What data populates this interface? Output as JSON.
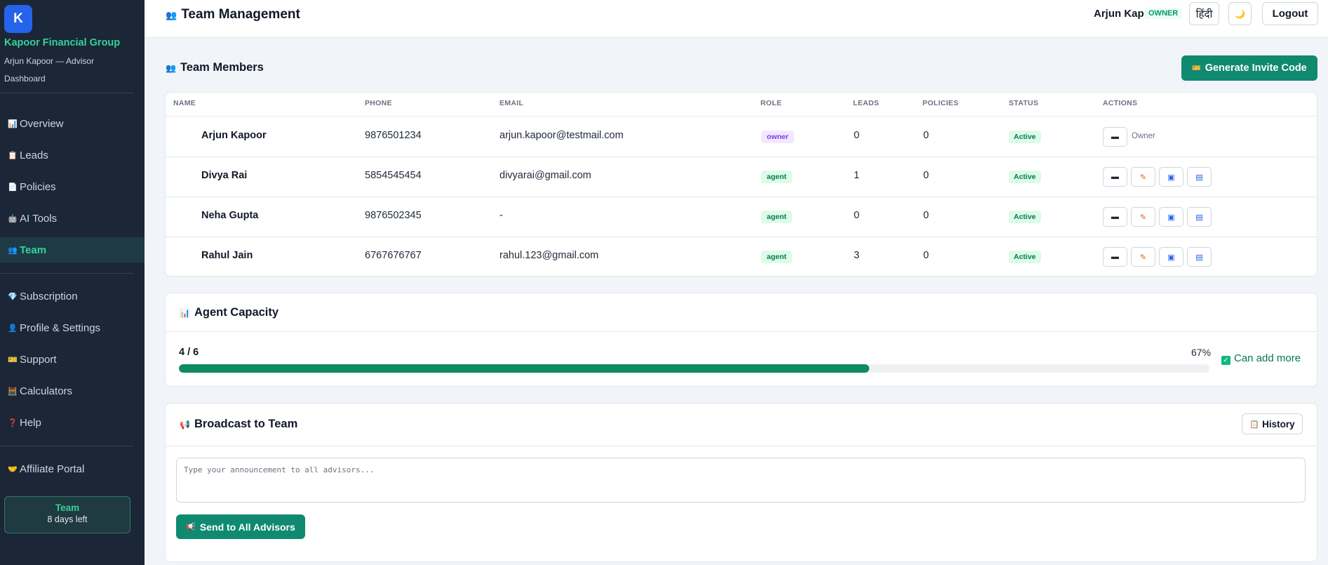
{
  "sidebar": {
    "logo_letter": "K",
    "org_name": "Kapoor Financial Group",
    "subtitle": "Arjun Kapoor — Advisor",
    "subtitle2": "Dashboard",
    "items": [
      {
        "icon": "📊",
        "label": "Overview"
      },
      {
        "icon": "📋",
        "label": "Leads"
      },
      {
        "icon": "📄",
        "label": "Policies"
      },
      {
        "icon": "🤖",
        "label": "AI Tools"
      },
      {
        "icon": "👥",
        "label": "Team"
      },
      {
        "icon": "💎",
        "label": "Subscription"
      },
      {
        "icon": "👤",
        "label": "Profile & Settings"
      },
      {
        "icon": "🎫",
        "label": "Support"
      },
      {
        "icon": "🧮",
        "label": "Calculators"
      },
      {
        "icon": "❓",
        "label": "Help"
      },
      {
        "icon": "🤝",
        "label": "Affiliate Portal"
      }
    ],
    "active_item": "Team",
    "trial": {
      "plan": "Team",
      "days_left": "8 days left"
    }
  },
  "header": {
    "icon": "👥",
    "title": "Team Management",
    "user_name": "Arjun Kapoor",
    "user_role": "OWNER",
    "lang_button": "हिंदी",
    "theme_icon": "🌙",
    "logout_label": "Logout"
  },
  "team_members": {
    "icon": "👥",
    "title": "Team Members",
    "invite_button": {
      "icon": "🎫",
      "label": "Generate Invite Code"
    },
    "columns": [
      "NAME",
      "PHONE",
      "EMAIL",
      "ROLE",
      "LEADS",
      "POLICIES",
      "STATUS",
      "ACTIONS"
    ],
    "rows": [
      {
        "name": "Arjun Kapoor",
        "phone": "9876501234",
        "email": "arjun.kapoor@testmail.com",
        "role": "owner",
        "leads": "0",
        "policies": "0",
        "status": "Active",
        "owner_tag": "Owner"
      },
      {
        "name": "Divya Rai",
        "phone": "5854545454",
        "email": "divyarai@gmail.com",
        "role": "agent",
        "leads": "1",
        "policies": "0",
        "status": "Active"
      },
      {
        "name": "Neha Gupta",
        "phone": "9876502345",
        "email": "-",
        "role": "agent",
        "leads": "0",
        "policies": "0",
        "status": "Active"
      },
      {
        "name": "Rahul Jain",
        "phone": "6767676767",
        "email": "rahul.123@gmail.com",
        "role": "agent",
        "leads": "3",
        "policies": "0",
        "status": "Active"
      }
    ]
  },
  "capacity": {
    "icon": "📊",
    "title": "Agent Capacity",
    "count": "4 / 6",
    "percent_label": "67%",
    "fill_fraction": 0.67,
    "note": "Can add more"
  },
  "broadcast": {
    "icon": "📢",
    "title": "Broadcast to Team",
    "history_icon": "📋",
    "history_label": "History",
    "placeholder": "Type your announcement to all advisors...",
    "send_icon": "📢",
    "send_label": "Send to All Advisors"
  },
  "colors": {
    "accent": "#0f8a70",
    "sidebar_bg": "#1b2637",
    "brand_green": "#34d399",
    "logo_blue": "#2563eb"
  }
}
